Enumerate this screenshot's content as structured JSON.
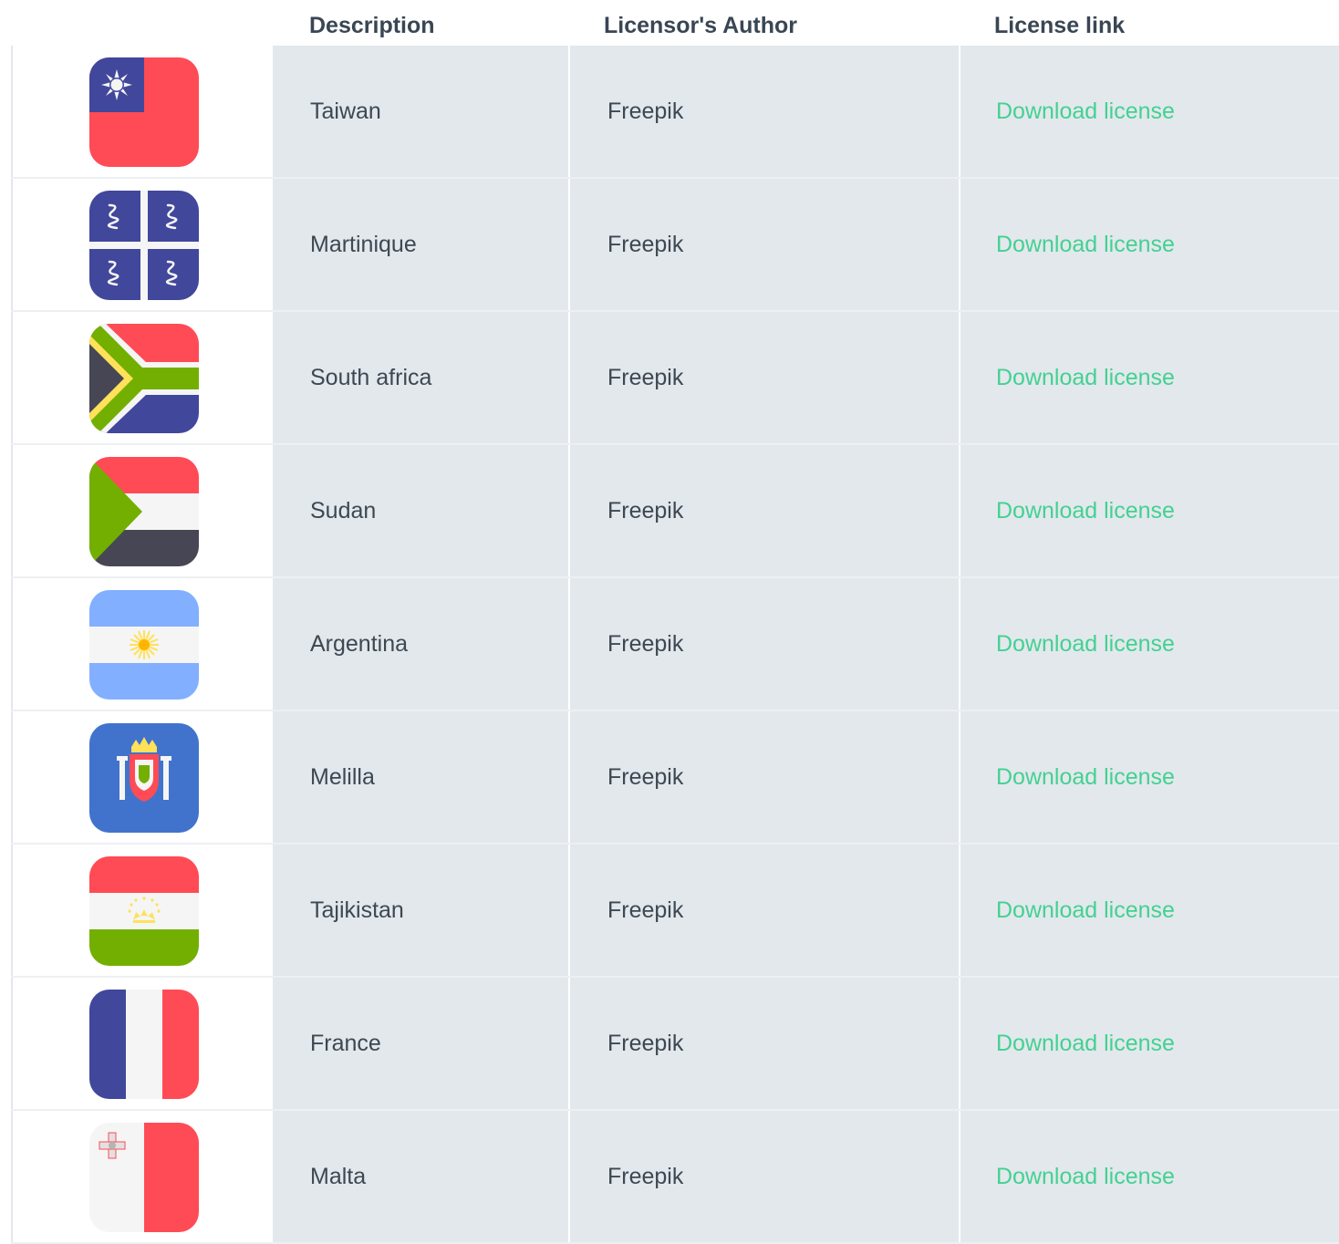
{
  "table": {
    "headers": {
      "description": "Description",
      "author": "Licensor's Author",
      "link": "License link"
    },
    "rows": [
      {
        "description": "Taiwan",
        "author": "Freepik",
        "link": "Download license",
        "flag_icon": "taiwan-flag-icon"
      },
      {
        "description": "Martinique",
        "author": "Freepik",
        "link": "Download license",
        "flag_icon": "martinique-flag-icon"
      },
      {
        "description": "South africa",
        "author": "Freepik",
        "link": "Download license",
        "flag_icon": "south-africa-flag-icon"
      },
      {
        "description": "Sudan",
        "author": "Freepik",
        "link": "Download license",
        "flag_icon": "sudan-flag-icon"
      },
      {
        "description": "Argentina",
        "author": "Freepik",
        "link": "Download license",
        "flag_icon": "argentina-flag-icon"
      },
      {
        "description": "Melilla",
        "author": "Freepik",
        "link": "Download license",
        "flag_icon": "melilla-flag-icon"
      },
      {
        "description": "Tajikistan",
        "author": "Freepik",
        "link": "Download license",
        "flag_icon": "tajikistan-flag-icon"
      },
      {
        "description": "France",
        "author": "Freepik",
        "link": "Download license",
        "flag_icon": "france-flag-icon"
      },
      {
        "description": "Malta",
        "author": "Freepik",
        "link": "Download license",
        "flag_icon": "malta-flag-icon"
      }
    ]
  },
  "colors": {
    "link": "#43d192",
    "cell_background": "#e3e8ec",
    "text": "#3d4852",
    "header_text": "#3a4653"
  }
}
